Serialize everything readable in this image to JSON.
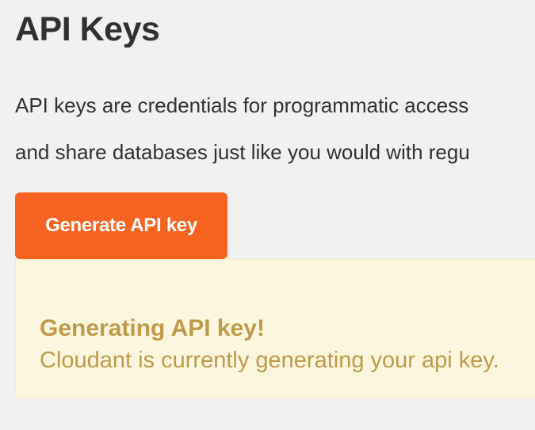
{
  "page": {
    "title": "API Keys"
  },
  "description": {
    "line_1": "API keys are credentials for programmatic access",
    "line_2": "and share databases just like you would with regu"
  },
  "actions": {
    "generate_api_key_label": "Generate API key"
  },
  "notice": {
    "title": "Generating API key!",
    "message": "Cloudant is currently generating your api key."
  },
  "colors": {
    "background": "#f1f1f1",
    "primary_button": "#f76321",
    "notice_background": "#fcf6df",
    "notice_text": "#c09a4a",
    "text": "#2f3133"
  }
}
